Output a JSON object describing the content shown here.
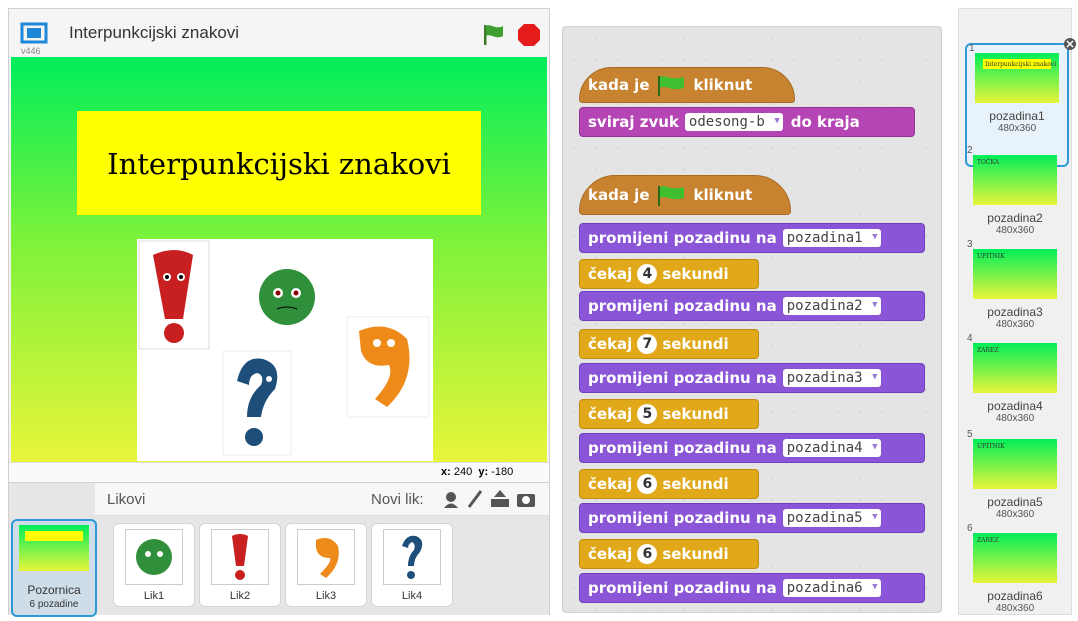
{
  "stage": {
    "title": "Interpunkcijski znakovi",
    "version": "v446",
    "canvas_title": "Interpunkcijski znakovi",
    "coords": {
      "x_label": "x:",
      "x": "240",
      "y_label": "y:",
      "y": "-180"
    }
  },
  "sprites_panel": {
    "label": "Likovi",
    "new_sprite_label": "Novi lik:",
    "stage_card": {
      "name": "Pozornica",
      "sub": "6 pozadine"
    },
    "sprites": [
      "Lik1",
      "Lik2",
      "Lik3",
      "Lik4"
    ]
  },
  "scripts": {
    "when_flag_pre": "kada je",
    "when_flag_post": "kliknut",
    "play_sound_pre": "sviraj zvuk",
    "sound_name": "odesong-b",
    "play_sound_post": "do kraja",
    "switch_backdrop": "promijeni pozadinu na",
    "wait_pre": "čekaj",
    "wait_post": "sekundi",
    "backdrops": [
      "pozadina1",
      "pozadina2",
      "pozadina3",
      "pozadina4",
      "pozadina5",
      "pozadina6"
    ],
    "waits": [
      "4",
      "7",
      "5",
      "6",
      "6"
    ]
  },
  "backdrops": [
    {
      "index": "1",
      "name": "pozadina1",
      "size": "480x360",
      "mini": "Interpunkcijski znakovi"
    },
    {
      "index": "2",
      "name": "pozadina2",
      "size": "480x360",
      "mini": "TOČKA"
    },
    {
      "index": "3",
      "name": "pozadina3",
      "size": "480x360",
      "mini": "UPITNIK"
    },
    {
      "index": "4",
      "name": "pozadina4",
      "size": "480x360",
      "mini": "ZAREZ"
    },
    {
      "index": "5",
      "name": "pozadina5",
      "size": "480x360",
      "mini": "UPITNIK"
    },
    {
      "index": "6",
      "name": "pozadina6",
      "size": "480x360",
      "mini": "ZAREZ"
    }
  ],
  "colors": {
    "accent": "#2f99d8",
    "motion_purple": "#8a55d7",
    "control_orange": "#e1a91a",
    "events_brown": "#c88330"
  }
}
